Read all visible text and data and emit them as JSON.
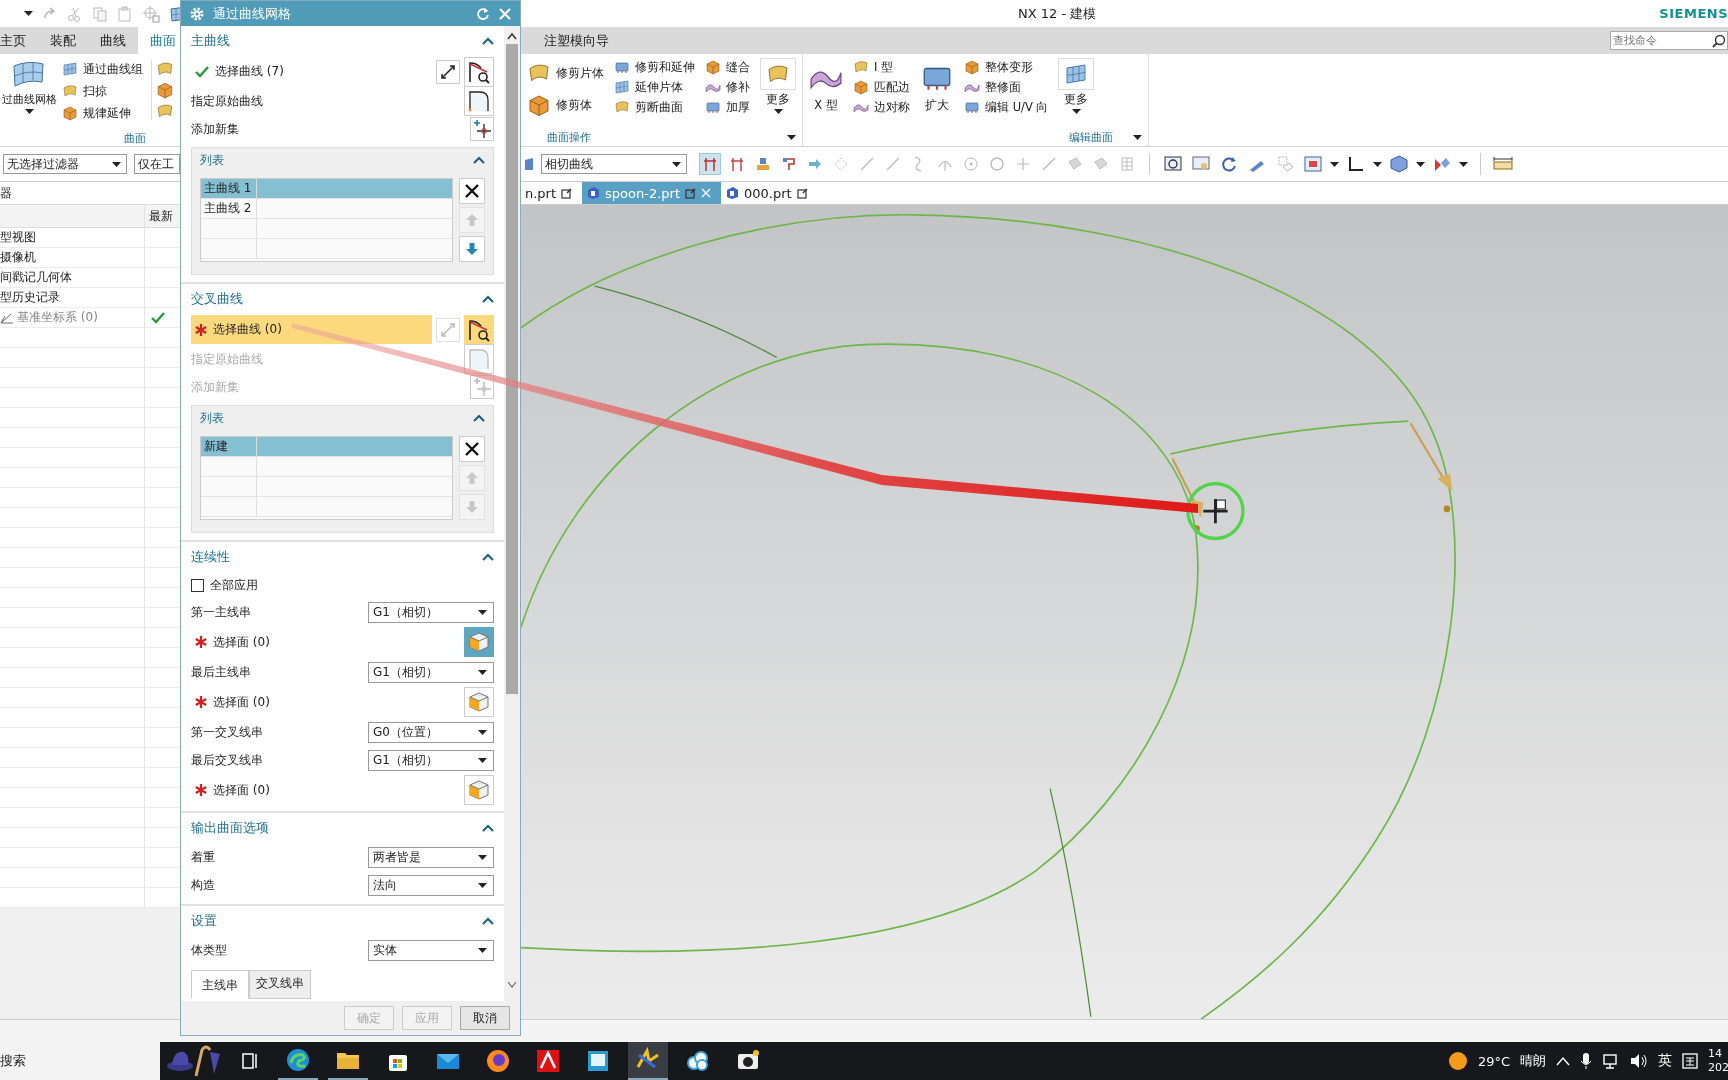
{
  "title_bar": {
    "title": "NX 12 - 建模",
    "brand": "SIEMENS"
  },
  "tabs": [
    {
      "label": "主页",
      "selected": false
    },
    {
      "label": "装配",
      "selected": false
    },
    {
      "label": "曲线",
      "selected": false
    },
    {
      "label": "曲面",
      "selected": true
    },
    {
      "label": "注塑模向导",
      "selected": false
    }
  ],
  "command_search": {
    "placeholder": "查找命令"
  },
  "ribbon_left": {
    "big_button": "过曲线网格",
    "items": [
      "通过曲线组",
      "扫掠",
      "规律延伸"
    ],
    "group_label": "曲面"
  },
  "ribbon_groups": [
    {
      "label": "曲面操作",
      "columns": [
        [
          {
            "kind": "small",
            "label": "修剪片体"
          },
          {
            "kind": "small",
            "label": "修剪体"
          }
        ],
        [
          {
            "kind": "small",
            "label": "修剪和延伸"
          },
          {
            "kind": "small",
            "label": "延伸片体"
          },
          {
            "kind": "small",
            "label": "剪断曲面"
          }
        ],
        [
          {
            "kind": "small",
            "label": "缝合"
          },
          {
            "kind": "small",
            "label": "修补"
          },
          {
            "kind": "small",
            "label": "加厚"
          }
        ],
        [
          {
            "kind": "more",
            "label": "更多"
          }
        ]
      ]
    },
    {
      "label": "编辑曲面",
      "columns": [
        [
          {
            "kind": "large",
            "label": "X 型"
          }
        ],
        [
          {
            "kind": "small",
            "label": "I 型"
          },
          {
            "kind": "small",
            "label": "匹配边"
          },
          {
            "kind": "small",
            "label": "边对称"
          }
        ],
        [
          {
            "kind": "large",
            "label": "扩大"
          }
        ],
        [
          {
            "kind": "small",
            "label": "整体变形"
          },
          {
            "kind": "small",
            "label": "整修面"
          },
          {
            "kind": "small",
            "label": "编辑 U/V 向"
          }
        ],
        [
          {
            "kind": "more",
            "label": "更多"
          }
        ]
      ]
    }
  ],
  "selection_filter": {
    "value": "无选择过滤器"
  },
  "selection_scope": {
    "value": "仅在工"
  },
  "curve_rule": {
    "value": "相切曲线"
  },
  "part_navigator": {
    "title": "器",
    "latest_column": "最新",
    "rows": [
      {
        "name": "型视图",
        "latest": false,
        "disabled": false
      },
      {
        "name": "摄像机",
        "latest": false,
        "disabled": false
      },
      {
        "name": "间戳记几何体",
        "latest": false,
        "disabled": false
      },
      {
        "name": "型历史记录",
        "latest": false,
        "disabled": false
      },
      {
        "name": "基准坐标系 (0)",
        "latest": true,
        "disabled": true
      }
    ]
  },
  "file_tabs": [
    {
      "label": "n.prt",
      "selected": false
    },
    {
      "label": "spoon-2.prt",
      "selected": true
    },
    {
      "label": "000.prt",
      "selected": false
    }
  ],
  "dialog": {
    "title": "通过曲线网格",
    "sections": [
      {
        "title": "主曲线",
        "expanded": true,
        "items": [
          {
            "kind": "select",
            "label": "选择曲线 (7)",
            "done": true,
            "active": false
          },
          {
            "kind": "origin_curve",
            "label": "指定原始曲线",
            "disabled": false
          },
          {
            "kind": "add_set",
            "label": "添加新集",
            "disabled": false
          },
          {
            "kind": "list",
            "title": "列表",
            "rows": [
              {
                "label": "主曲线 1",
                "selected": true
              },
              {
                "label": "主曲线 2",
                "selected": false
              }
            ],
            "up_disabled": true,
            "down_disabled": false
          }
        ]
      },
      {
        "title": "交叉曲线",
        "expanded": true,
        "items": [
          {
            "kind": "select",
            "label": "选择曲线 (0)",
            "done": false,
            "active": true
          },
          {
            "kind": "origin_curve",
            "label": "指定原始曲线",
            "disabled": true
          },
          {
            "kind": "add_set",
            "label": "添加新集",
            "disabled": true
          },
          {
            "kind": "list",
            "title": "列表",
            "rows": [
              {
                "label": "新建",
                "selected": true
              }
            ],
            "up_disabled": true,
            "down_disabled": true
          }
        ]
      },
      {
        "title": "连续性",
        "expanded": true,
        "items": [
          {
            "kind": "checkbox",
            "label": "全部应用",
            "checked": false
          },
          {
            "kind": "dropdown",
            "label": "第一主线串",
            "value": "G1（相切）"
          },
          {
            "kind": "face",
            "label": "选择面 (0)",
            "active": true
          },
          {
            "kind": "dropdown",
            "label": "最后主线串",
            "value": "G1（相切）"
          },
          {
            "kind": "face",
            "label": "选择面 (0)",
            "active": false
          },
          {
            "kind": "dropdown",
            "label": "第一交叉线串",
            "value": "G0（位置）"
          },
          {
            "kind": "dropdown",
            "label": "最后交叉线串",
            "value": "G1（相切）"
          },
          {
            "kind": "face",
            "label": "选择面 (0)",
            "active": false
          }
        ]
      },
      {
        "title": "输出曲面选项",
        "expanded": true,
        "items": [
          {
            "kind": "dropdown",
            "label": "着重",
            "value": "两者皆是"
          },
          {
            "kind": "dropdown",
            "label": "构造",
            "value": "法向"
          }
        ]
      },
      {
        "title": "设置",
        "expanded": true,
        "items": [
          {
            "kind": "dropdown",
            "label": "体类型",
            "value": "实体"
          },
          {
            "kind": "tabs",
            "tabs": [
              {
                "label": "主线串",
                "selected": true
              },
              {
                "label": "交叉线串",
                "selected": false
              }
            ]
          }
        ]
      }
    ],
    "buttons": [
      {
        "label": "确定",
        "disabled": true
      },
      {
        "label": "应用",
        "disabled": true
      },
      {
        "label": "取消",
        "disabled": false
      }
    ]
  },
  "taskbar": {
    "search": "搜索",
    "temperature": "29°C",
    "condition": "晴朗",
    "input_method": "英",
    "time": "14",
    "date": "202"
  }
}
